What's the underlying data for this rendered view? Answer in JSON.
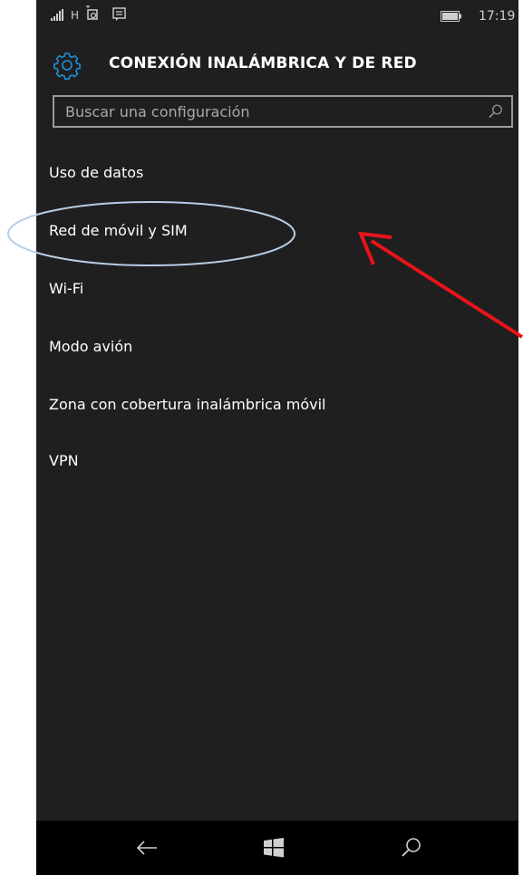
{
  "status_bar": {
    "network_type": "H",
    "time": "17:19",
    "icons": [
      "signal-icon",
      "phone-icon",
      "message-icon",
      "battery-icon"
    ]
  },
  "header": {
    "title": "CONEXIÓN INALÁMBRICA Y DE RED",
    "icon": "gear-icon"
  },
  "search": {
    "placeholder": "Buscar una configuración",
    "value": "",
    "icon": "search-icon"
  },
  "menu": {
    "items": [
      {
        "label": "Uso de datos"
      },
      {
        "label": "Red de móvil y SIM"
      },
      {
        "label": "Wi-Fi"
      },
      {
        "label": "Modo avión"
      },
      {
        "label": "Zona con cobertura inalámbrica móvil"
      },
      {
        "label": "VPN"
      }
    ]
  },
  "nav_bar": {
    "buttons": [
      "back-arrow-icon",
      "windows-icon",
      "search-icon"
    ]
  },
  "colors": {
    "background": "#1f1f1f",
    "accent": "#1e90d6",
    "text": "#ffffff",
    "annotation_circle": "#b8cde6",
    "annotation_arrow": "#e8141a"
  }
}
